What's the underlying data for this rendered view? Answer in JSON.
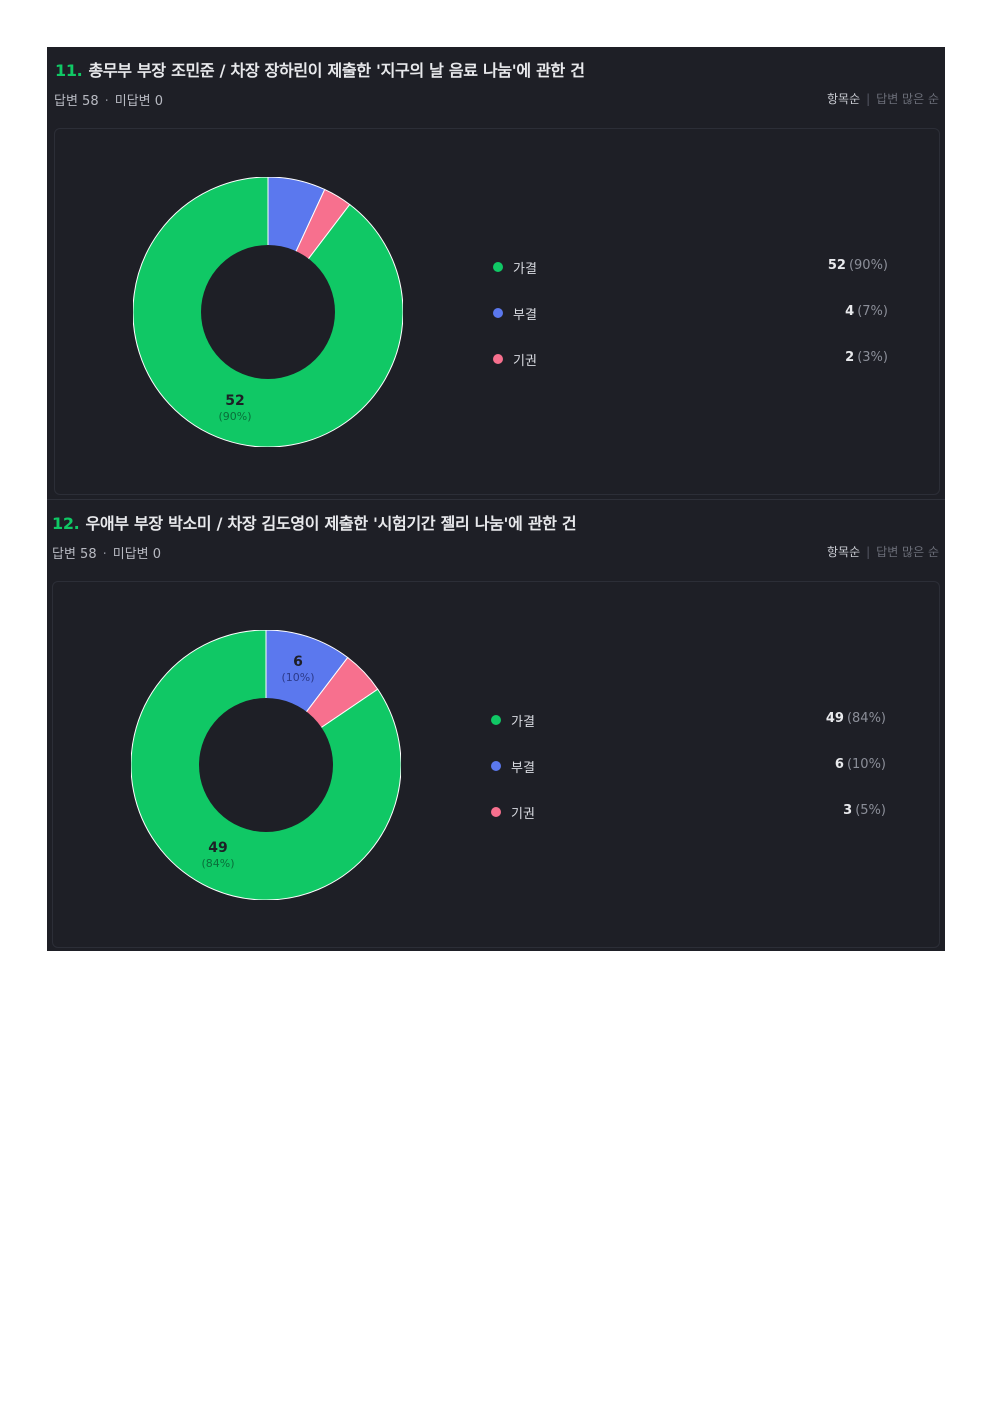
{
  "colors": {
    "pass": "#10c865",
    "reject": "#5b78ee",
    "abstain": "#f7708e",
    "hole": "#1e1f26"
  },
  "sort": {
    "by_item": "항목순",
    "by_answers": "답변 많은 순"
  },
  "questions": [
    {
      "number": "11.",
      "title": "총무부 부장 조민준 / 차장 장하린이 제출한 '지구의 날 음료 나눔'에 관한 건",
      "answered": "답변 58",
      "unanswered": "미답변 0",
      "options": [
        {
          "label": "가결",
          "count": "52",
          "pct": "(90%)"
        },
        {
          "label": "부결",
          "count": "4",
          "pct": "(7%)"
        },
        {
          "label": "기권",
          "count": "2",
          "pct": "(3%)"
        }
      ],
      "slice_labels": [
        {
          "count": "52",
          "pct": "(90%)"
        }
      ]
    },
    {
      "number": "12.",
      "title": "우애부 부장 박소미 / 차장 김도영이 제출한 '시험기간 젤리 나눔'에 관한 건",
      "answered": "답변 58",
      "unanswered": "미답변 0",
      "options": [
        {
          "label": "가결",
          "count": "49",
          "pct": "(84%)"
        },
        {
          "label": "부결",
          "count": "6",
          "pct": "(10%)"
        },
        {
          "label": "기권",
          "count": "3",
          "pct": "(5%)"
        }
      ],
      "slice_labels": [
        {
          "count": "6",
          "pct": "(10%)"
        },
        {
          "count": "49",
          "pct": "(84%)"
        }
      ]
    }
  ],
  "chart_data": [
    {
      "type": "pie",
      "categories": [
        "가결",
        "부결",
        "기권"
      ],
      "values": [
        52,
        4,
        2
      ],
      "percentages": [
        90,
        7,
        3
      ]
    },
    {
      "type": "pie",
      "categories": [
        "가결",
        "부결",
        "기권"
      ],
      "values": [
        49,
        6,
        3
      ],
      "percentages": [
        84,
        10,
        5
      ]
    }
  ]
}
